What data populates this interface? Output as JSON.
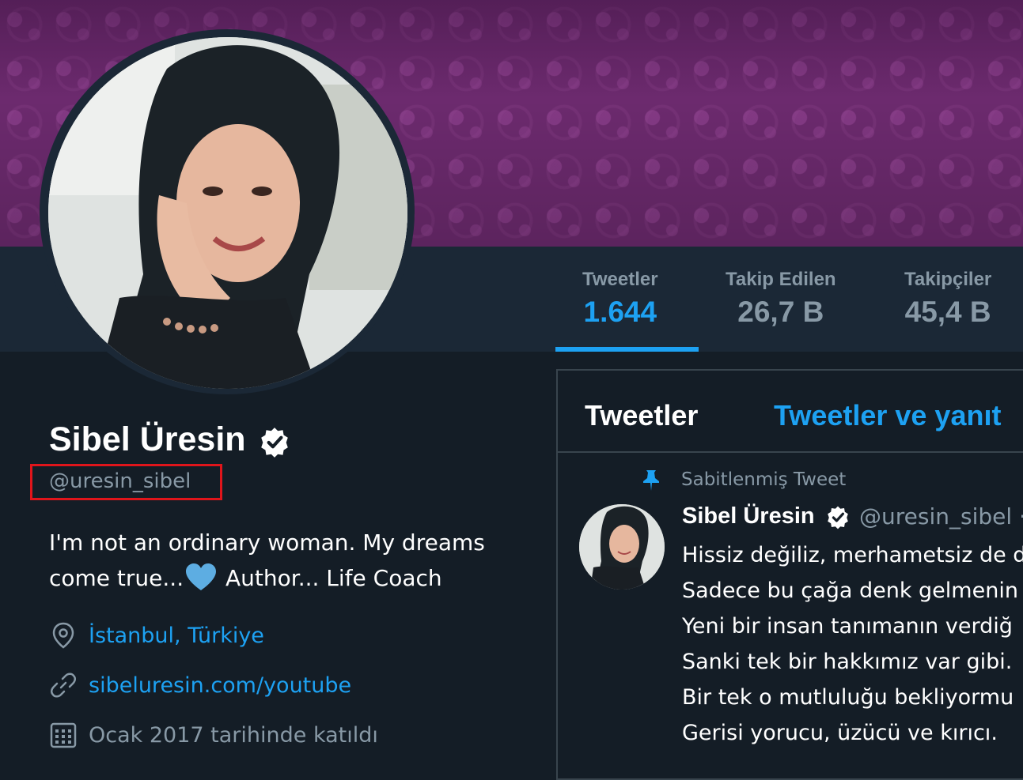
{
  "banner": {
    "color": "#6c2a6e"
  },
  "stats": [
    {
      "label": "Tweetler",
      "value": "1.644",
      "active": true
    },
    {
      "label": "Takip Edilen",
      "value": "26,7 B"
    },
    {
      "label": "Takipçiler",
      "value": "45,4 B"
    }
  ],
  "profile": {
    "name": "Sibel Üresin",
    "handle": "@uresin_sibel",
    "bio_line1": "I'm not an ordinary woman. My dreams",
    "bio_line2_a": "come true...",
    "bio_line2_b": " Author... Life Coach",
    "location": "İstanbul, Türkiye",
    "website": "sibeluresin.com/youtube",
    "joined": "Ocak 2017 tarihinde katıldı"
  },
  "timeline": {
    "tabs": [
      "Tweetler",
      "Tweetler ve yanıt"
    ],
    "pinned_label": "Sabitlenmiş Tweet",
    "tweet": {
      "name": "Sibel Üresin",
      "handle": "@uresin_sibel ·",
      "lines": [
        "Hissiz değiliz, merhametsiz de d",
        "Sadece bu çağa denk gelmenin",
        "Yeni bir insan tanımanın verdiğ",
        "Sanki tek bir hakkımız var gibi.",
        "Bir tek o mutluluğu bekliyormu",
        "Gerisi yorucu, üzücü ve kırıcı."
      ]
    }
  },
  "colors": {
    "accent": "#1da1f2",
    "background": "#141d26",
    "highlight_box": "#e0151b"
  }
}
